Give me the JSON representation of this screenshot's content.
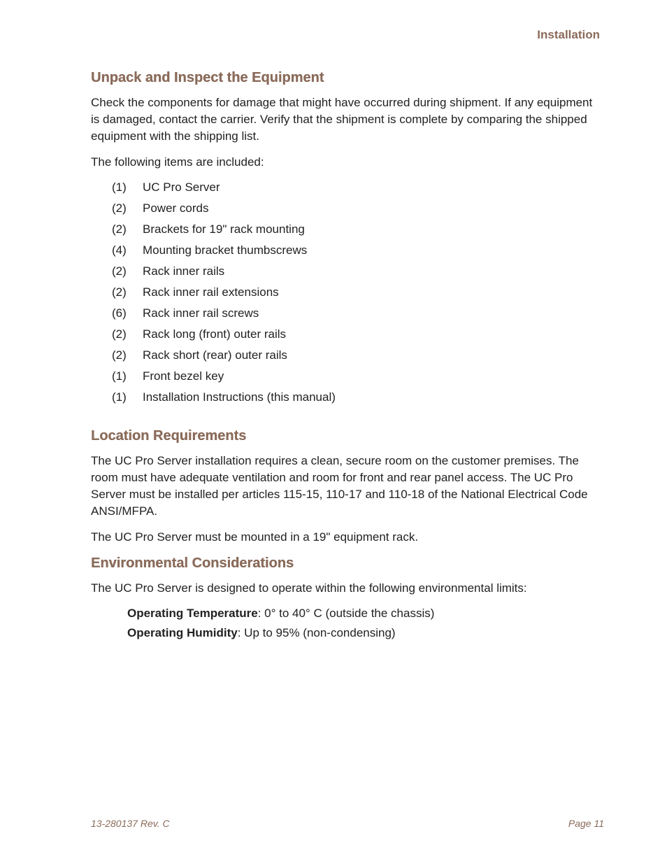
{
  "header": {
    "section_label": "Installation"
  },
  "sections": {
    "unpack": {
      "title": "Unpack and Inspect the Equipment",
      "p1": "Check the components for damage that might have occurred during shipment. If any equipment is damaged, contact the carrier. Verify that the shipment is complete by comparing the shipped equipment with the shipping list.",
      "p2": "The following items are included:",
      "items": [
        {
          "qty": "(1)",
          "desc": "UC Pro Server"
        },
        {
          "qty": "(2)",
          "desc": "Power cords"
        },
        {
          "qty": "(2)",
          "desc": "Brackets for 19\" rack mounting"
        },
        {
          "qty": "(4)",
          "desc": "Mounting bracket thumbscrews"
        },
        {
          "qty": "(2)",
          "desc": "Rack inner rails"
        },
        {
          "qty": "(2)",
          "desc": "Rack inner rail extensions"
        },
        {
          "qty": "(6)",
          "desc": "Rack inner rail screws"
        },
        {
          "qty": "(2)",
          "desc": "Rack long (front) outer rails"
        },
        {
          "qty": "(2)",
          "desc": "Rack short (rear) outer rails"
        },
        {
          "qty": "(1)",
          "desc": "Front bezel key"
        },
        {
          "qty": "(1)",
          "desc": "Installation Instructions (this manual)"
        }
      ]
    },
    "location": {
      "title": "Location Requirements",
      "p1": "The UC Pro Server installation requires a clean, secure room on the customer premises. The room must have adequate ventilation and room for front and rear panel access. The UC Pro Server must be installed per articles 115-15, 110-17 and 110-18 of the National Electrical Code ANSI/MFPA.",
      "p2": "The UC Pro Server must be mounted in a 19\" equipment rack."
    },
    "env": {
      "title": "Environmental Considerations",
      "p1": "The UC Pro Server is designed to operate within the following environmental limits:",
      "specs": {
        "temp_label": "Operating Temperature",
        "temp_value": ": 0° to 40° C (outside the chassis)",
        "hum_label": "Operating Humidity",
        "hum_value": ": Up to 95% (non-condensing)"
      }
    }
  },
  "footer": {
    "doc_id": "13-280137  Rev. C",
    "page": "Page 11"
  }
}
